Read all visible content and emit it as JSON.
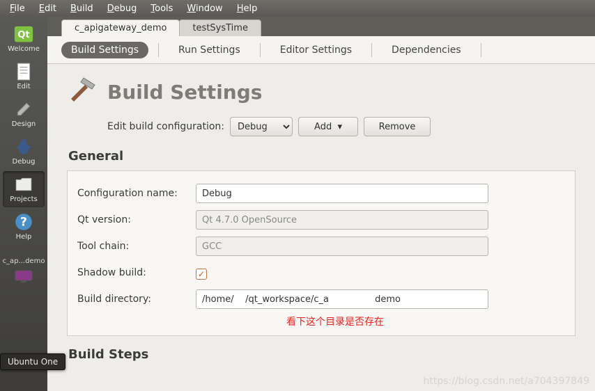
{
  "menu": {
    "file": "File",
    "edit": "Edit",
    "build": "Build",
    "debug": "Debug",
    "tools": "Tools",
    "window": "Window",
    "help": "Help"
  },
  "sidebar": {
    "items": [
      {
        "label": "Welcome"
      },
      {
        "label": "Edit"
      },
      {
        "label": "Design"
      },
      {
        "label": "Debug"
      },
      {
        "label": "Projects"
      },
      {
        "label": "Help"
      }
    ],
    "truncated_project": "c_ap...demo"
  },
  "tooltip": "Ubuntu One",
  "tabs": [
    {
      "label": "c_apigateway_demo"
    },
    {
      "label": "testSysTime"
    }
  ],
  "subtabs": {
    "build": "Build Settings",
    "run": "Run Settings",
    "editor": "Editor Settings",
    "deps": "Dependencies"
  },
  "page": {
    "title": "Build Settings",
    "cfg_label": "Edit build configuration:",
    "cfg_value": "Debug",
    "btn_add": "Add",
    "btn_remove": "Remove",
    "general": "General",
    "fields": {
      "conf_name_label": "Configuration name:",
      "conf_name": "Debug",
      "qt_label": "Qt version:",
      "qt_value": "Qt 4.7.0 OpenSource",
      "tool_label": "Tool chain:",
      "tool_value": "GCC",
      "shadow_label": "Shadow build:",
      "shadow_checked": true,
      "dir_label": "Build directory:",
      "dir_value": "/home/    /qt_workspace/c_a                demo"
    },
    "steps": "Build Steps",
    "annotation": "看下这个目录是否存在"
  },
  "watermark": "https://blog.csdn.net/a704397849"
}
